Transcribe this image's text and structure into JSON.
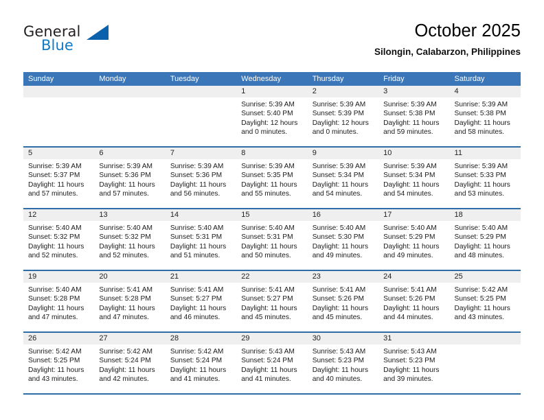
{
  "logo": {
    "word_one": "General",
    "word_two": "Blue",
    "mark": "triangle-mark"
  },
  "header": {
    "title": "October 2025",
    "subtitle": "Silongin, Calabarzon, Philippines"
  },
  "calendar": {
    "weekdays": [
      "Sunday",
      "Monday",
      "Tuesday",
      "Wednesday",
      "Thursday",
      "Friday",
      "Saturday"
    ],
    "weeks": [
      [
        {
          "day": "",
          "lines": []
        },
        {
          "day": "",
          "lines": []
        },
        {
          "day": "",
          "lines": []
        },
        {
          "day": "1",
          "lines": [
            "Sunrise: 5:39 AM",
            "Sunset: 5:40 PM",
            "Daylight: 12 hours and 0 minutes."
          ]
        },
        {
          "day": "2",
          "lines": [
            "Sunrise: 5:39 AM",
            "Sunset: 5:39 PM",
            "Daylight: 12 hours and 0 minutes."
          ]
        },
        {
          "day": "3",
          "lines": [
            "Sunrise: 5:39 AM",
            "Sunset: 5:38 PM",
            "Daylight: 11 hours and 59 minutes."
          ]
        },
        {
          "day": "4",
          "lines": [
            "Sunrise: 5:39 AM",
            "Sunset: 5:38 PM",
            "Daylight: 11 hours and 58 minutes."
          ]
        }
      ],
      [
        {
          "day": "5",
          "lines": [
            "Sunrise: 5:39 AM",
            "Sunset: 5:37 PM",
            "Daylight: 11 hours and 57 minutes."
          ]
        },
        {
          "day": "6",
          "lines": [
            "Sunrise: 5:39 AM",
            "Sunset: 5:36 PM",
            "Daylight: 11 hours and 57 minutes."
          ]
        },
        {
          "day": "7",
          "lines": [
            "Sunrise: 5:39 AM",
            "Sunset: 5:36 PM",
            "Daylight: 11 hours and 56 minutes."
          ]
        },
        {
          "day": "8",
          "lines": [
            "Sunrise: 5:39 AM",
            "Sunset: 5:35 PM",
            "Daylight: 11 hours and 55 minutes."
          ]
        },
        {
          "day": "9",
          "lines": [
            "Sunrise: 5:39 AM",
            "Sunset: 5:34 PM",
            "Daylight: 11 hours and 54 minutes."
          ]
        },
        {
          "day": "10",
          "lines": [
            "Sunrise: 5:39 AM",
            "Sunset: 5:34 PM",
            "Daylight: 11 hours and 54 minutes."
          ]
        },
        {
          "day": "11",
          "lines": [
            "Sunrise: 5:39 AM",
            "Sunset: 5:33 PM",
            "Daylight: 11 hours and 53 minutes."
          ]
        }
      ],
      [
        {
          "day": "12",
          "lines": [
            "Sunrise: 5:40 AM",
            "Sunset: 5:32 PM",
            "Daylight: 11 hours and 52 minutes."
          ]
        },
        {
          "day": "13",
          "lines": [
            "Sunrise: 5:40 AM",
            "Sunset: 5:32 PM",
            "Daylight: 11 hours and 52 minutes."
          ]
        },
        {
          "day": "14",
          "lines": [
            "Sunrise: 5:40 AM",
            "Sunset: 5:31 PM",
            "Daylight: 11 hours and 51 minutes."
          ]
        },
        {
          "day": "15",
          "lines": [
            "Sunrise: 5:40 AM",
            "Sunset: 5:31 PM",
            "Daylight: 11 hours and 50 minutes."
          ]
        },
        {
          "day": "16",
          "lines": [
            "Sunrise: 5:40 AM",
            "Sunset: 5:30 PM",
            "Daylight: 11 hours and 49 minutes."
          ]
        },
        {
          "day": "17",
          "lines": [
            "Sunrise: 5:40 AM",
            "Sunset: 5:29 PM",
            "Daylight: 11 hours and 49 minutes."
          ]
        },
        {
          "day": "18",
          "lines": [
            "Sunrise: 5:40 AM",
            "Sunset: 5:29 PM",
            "Daylight: 11 hours and 48 minutes."
          ]
        }
      ],
      [
        {
          "day": "19",
          "lines": [
            "Sunrise: 5:40 AM",
            "Sunset: 5:28 PM",
            "Daylight: 11 hours and 47 minutes."
          ]
        },
        {
          "day": "20",
          "lines": [
            "Sunrise: 5:41 AM",
            "Sunset: 5:28 PM",
            "Daylight: 11 hours and 47 minutes."
          ]
        },
        {
          "day": "21",
          "lines": [
            "Sunrise: 5:41 AM",
            "Sunset: 5:27 PM",
            "Daylight: 11 hours and 46 minutes."
          ]
        },
        {
          "day": "22",
          "lines": [
            "Sunrise: 5:41 AM",
            "Sunset: 5:27 PM",
            "Daylight: 11 hours and 45 minutes."
          ]
        },
        {
          "day": "23",
          "lines": [
            "Sunrise: 5:41 AM",
            "Sunset: 5:26 PM",
            "Daylight: 11 hours and 45 minutes."
          ]
        },
        {
          "day": "24",
          "lines": [
            "Sunrise: 5:41 AM",
            "Sunset: 5:26 PM",
            "Daylight: 11 hours and 44 minutes."
          ]
        },
        {
          "day": "25",
          "lines": [
            "Sunrise: 5:42 AM",
            "Sunset: 5:25 PM",
            "Daylight: 11 hours and 43 minutes."
          ]
        }
      ],
      [
        {
          "day": "26",
          "lines": [
            "Sunrise: 5:42 AM",
            "Sunset: 5:25 PM",
            "Daylight: 11 hours and 43 minutes."
          ]
        },
        {
          "day": "27",
          "lines": [
            "Sunrise: 5:42 AM",
            "Sunset: 5:24 PM",
            "Daylight: 11 hours and 42 minutes."
          ]
        },
        {
          "day": "28",
          "lines": [
            "Sunrise: 5:42 AM",
            "Sunset: 5:24 PM",
            "Daylight: 11 hours and 41 minutes."
          ]
        },
        {
          "day": "29",
          "lines": [
            "Sunrise: 5:43 AM",
            "Sunset: 5:24 PM",
            "Daylight: 11 hours and 41 minutes."
          ]
        },
        {
          "day": "30",
          "lines": [
            "Sunrise: 5:43 AM",
            "Sunset: 5:23 PM",
            "Daylight: 11 hours and 40 minutes."
          ]
        },
        {
          "day": "31",
          "lines": [
            "Sunrise: 5:43 AM",
            "Sunset: 5:23 PM",
            "Daylight: 11 hours and 39 minutes."
          ]
        },
        {
          "day": "",
          "lines": []
        }
      ]
    ]
  },
  "colors": {
    "header_bar": "#3a76b8",
    "week_divider": "#2e6ca8",
    "daynum_band": "#efefef",
    "logo_blue": "#1279c4",
    "logo_triangle": "#0a62ad"
  }
}
